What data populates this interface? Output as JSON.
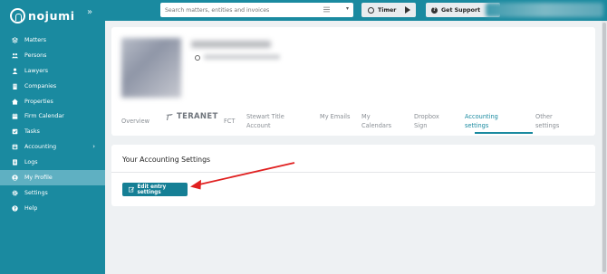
{
  "app": {
    "logo_text": "nojumi"
  },
  "topbar": {
    "search_placeholder": "Search matters, entities and invoices",
    "timer_label": "Timer",
    "support_label": "Get Support"
  },
  "sidebar": {
    "items": [
      {
        "label": "Matters",
        "icon": "layers-icon"
      },
      {
        "label": "Persons",
        "icon": "people-icon"
      },
      {
        "label": "Lawyers",
        "icon": "user-icon"
      },
      {
        "label": "Companies",
        "icon": "building-icon"
      },
      {
        "label": "Properties",
        "icon": "home-icon"
      },
      {
        "label": "Firm Calendar",
        "icon": "calendar-icon"
      },
      {
        "label": "Tasks",
        "icon": "checkbox-icon"
      },
      {
        "label": "Accounting",
        "icon": "accounting-icon"
      },
      {
        "label": "Logs",
        "icon": "list-icon"
      },
      {
        "label": "My Profile",
        "icon": "profile-icon"
      },
      {
        "label": "Settings",
        "icon": "gear-icon"
      },
      {
        "label": "Help",
        "icon": "help-icon"
      }
    ],
    "active_item": "My Profile"
  },
  "profile": {
    "tabs": [
      {
        "label": "Overview"
      },
      {
        "label": "TERANET"
      },
      {
        "label": "FCT"
      },
      {
        "label": "Stewart Title Account"
      },
      {
        "label": "My Emails"
      },
      {
        "label": "My Calendars"
      },
      {
        "label": "Dropbox Sign"
      },
      {
        "label": "Accounting settings"
      },
      {
        "label": "Other settings"
      }
    ],
    "active_tab": "Accounting settings"
  },
  "settings": {
    "title": "Your Accounting Settings",
    "edit_button": "Edit entry settings"
  },
  "colors": {
    "brand": "#1a8aa0",
    "active_nav": "#5fb0c2",
    "button": "#157f95",
    "annotation_arrow": "#e02020"
  }
}
